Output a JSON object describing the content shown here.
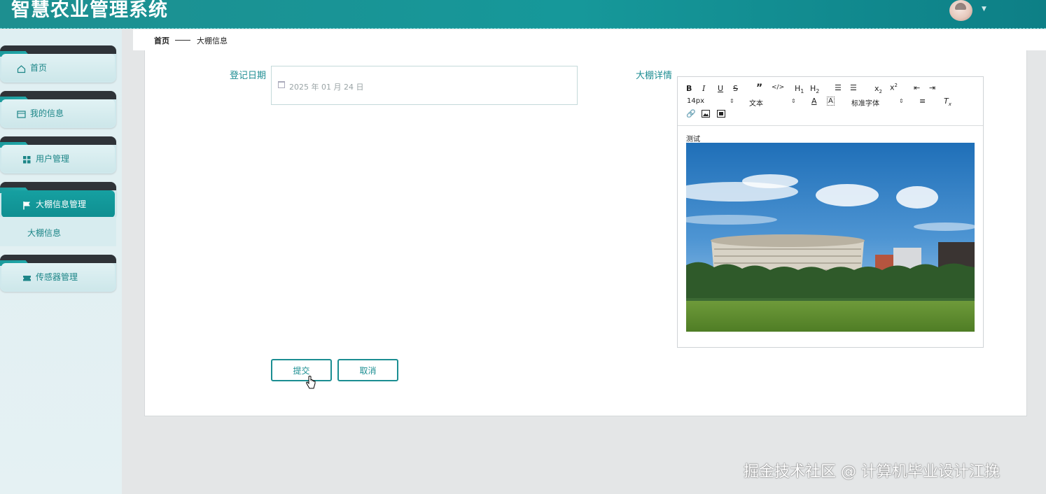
{
  "header": {
    "title": "智慧农业管理系统"
  },
  "sidebar": {
    "items": [
      {
        "label": "首页",
        "icon": "home-icon"
      },
      {
        "label": "我的信息",
        "icon": "profile-icon"
      },
      {
        "label": "用户管理",
        "icon": "grid-icon"
      },
      {
        "label": "大棚信息管理",
        "icon": "flag-icon",
        "active": true
      },
      {
        "label": "传感器管理",
        "icon": "ticket-icon"
      }
    ],
    "subitem": {
      "label": "大棚信息"
    }
  },
  "breadcrumb": {
    "home": "首页",
    "current": "大棚信息"
  },
  "form": {
    "date_label": "登记日期",
    "date_value": "2025 年 01 月 24 日",
    "detail_label": "大棚详情",
    "editor": {
      "font_size": "14px",
      "paragraph": "文本",
      "font_family": "标准字体",
      "content_text": "测试"
    },
    "submit_label": "提交",
    "cancel_label": "取消"
  },
  "watermark": "掘金技术社区 @ 计算机毕业设计江挽",
  "colors": {
    "accent": "#16989a",
    "accent_text": "#1d8688",
    "sidebar_bg": "#dfeff2"
  }
}
